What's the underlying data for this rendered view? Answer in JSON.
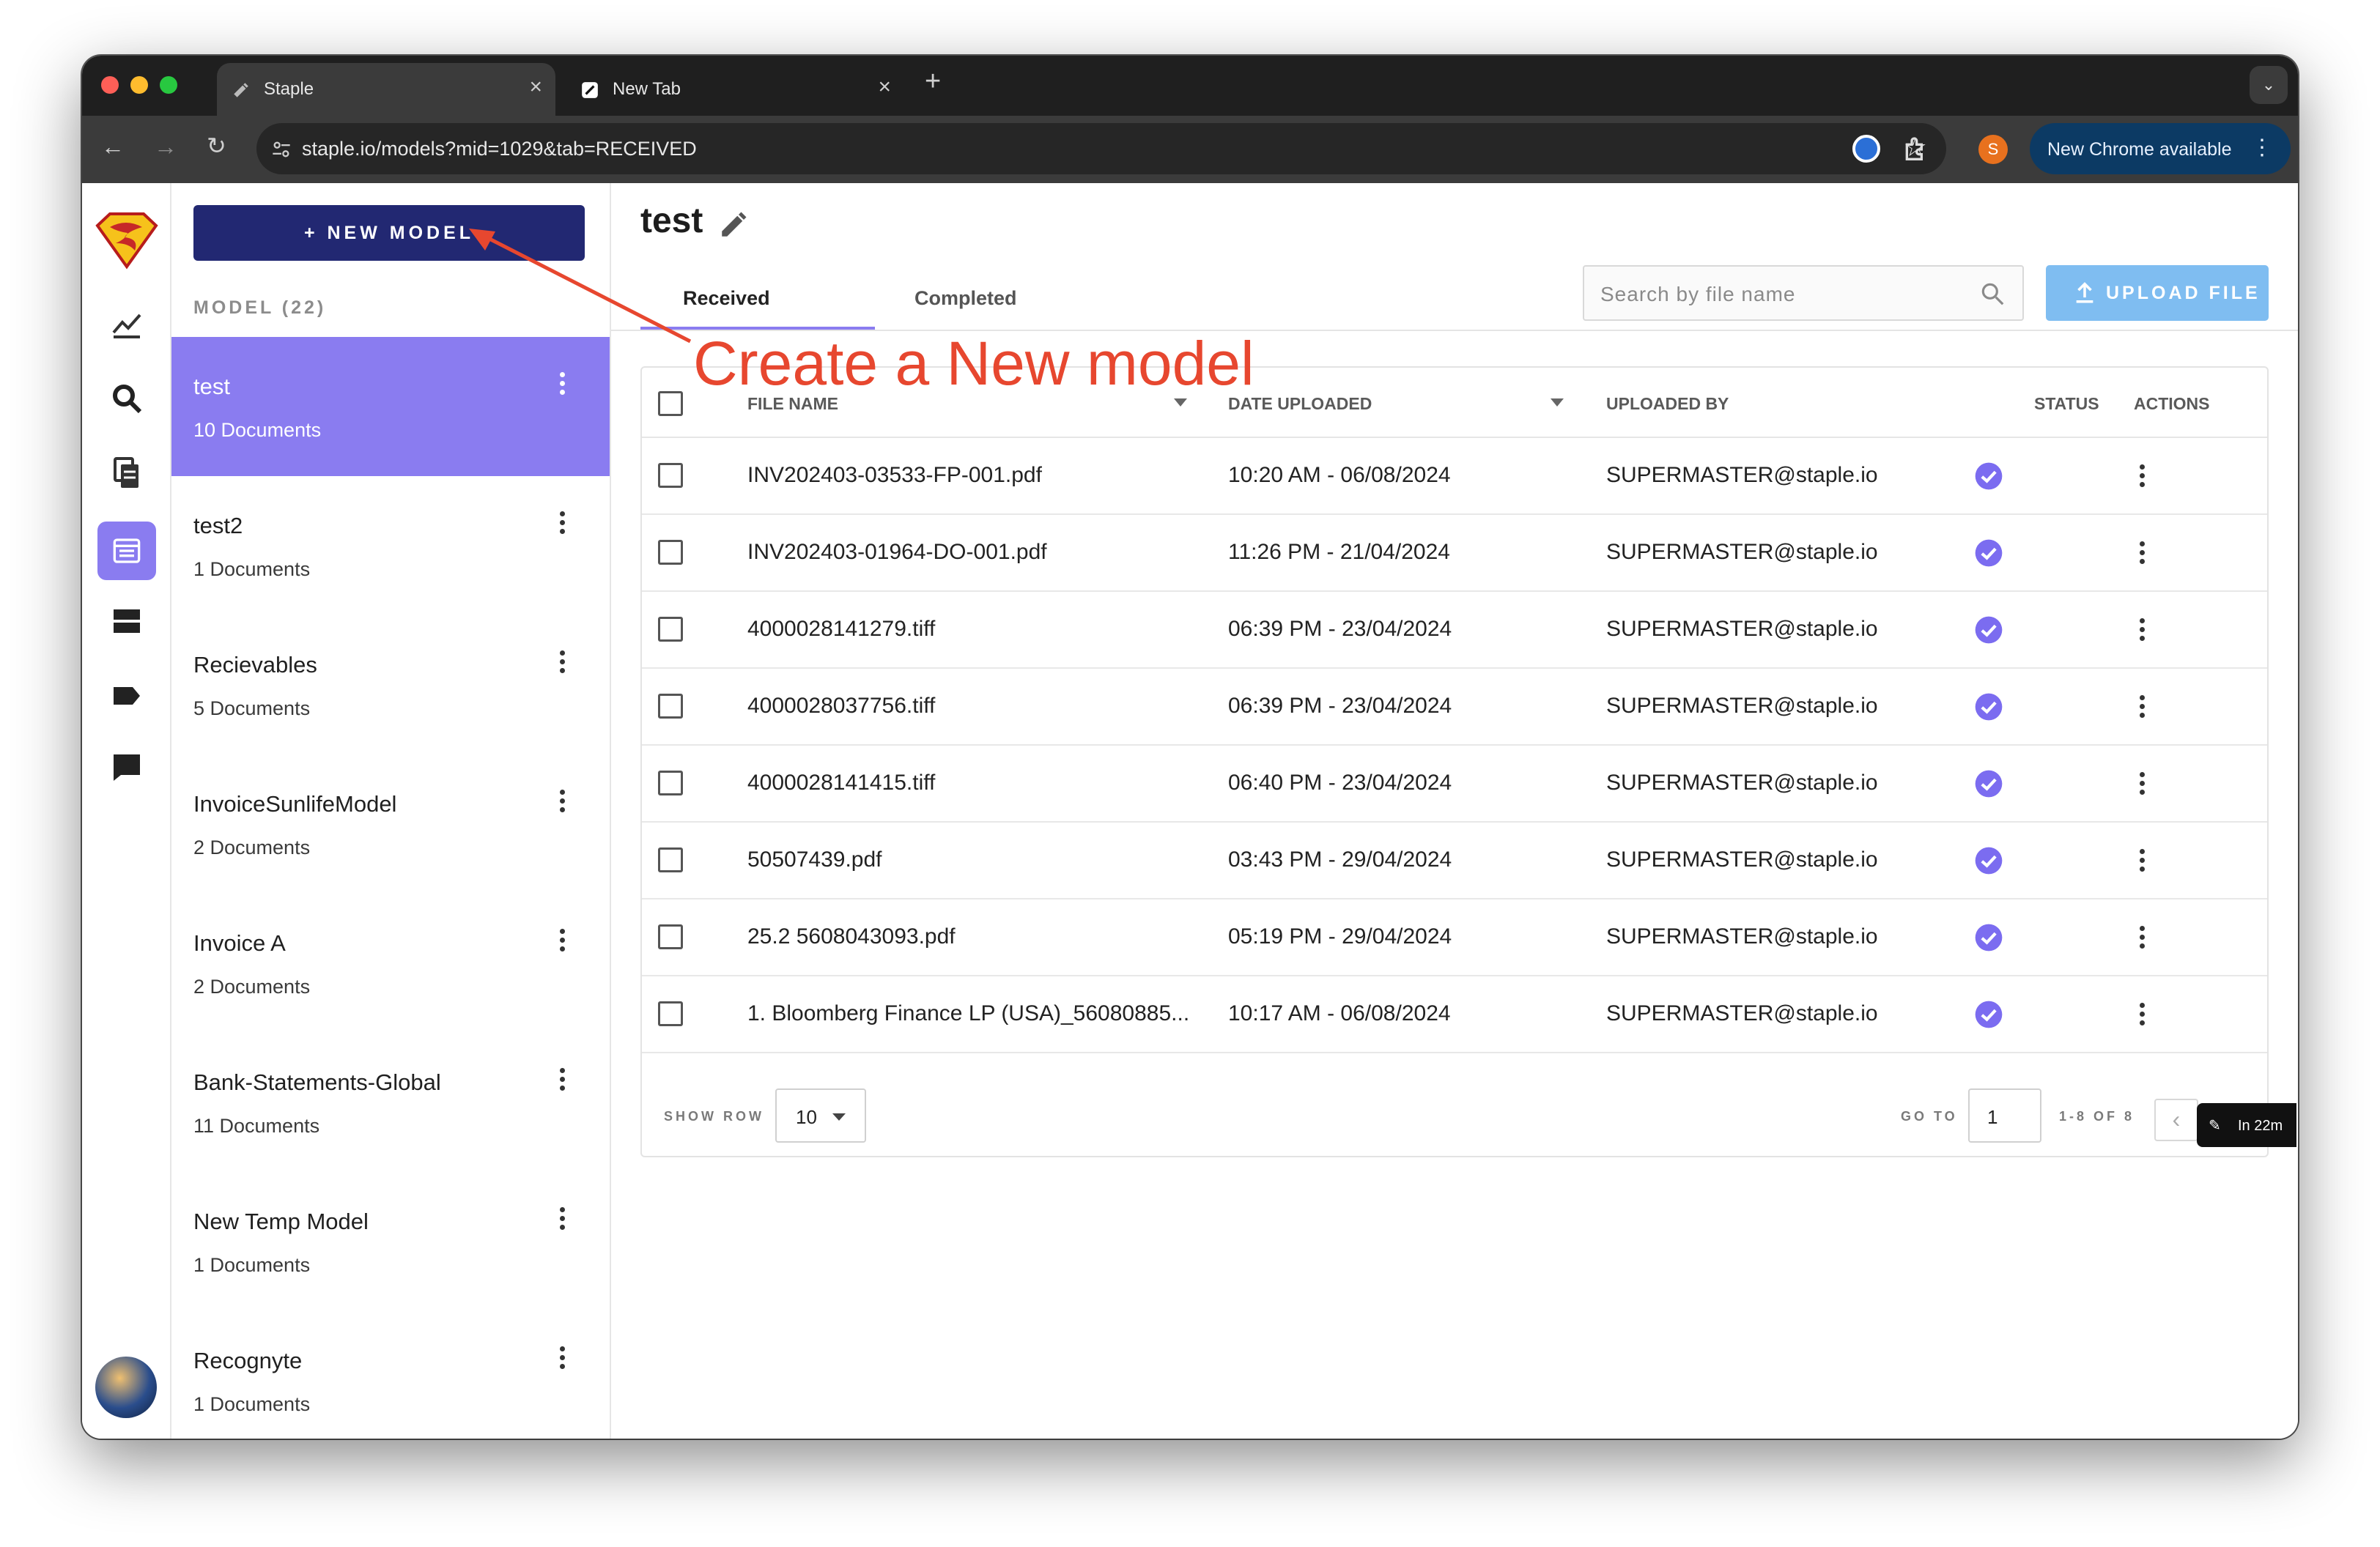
{
  "browser": {
    "tabs": [
      {
        "title": "Staple",
        "active": true
      },
      {
        "title": "New Tab",
        "active": false
      }
    ],
    "url": "staple.io/models?mid=1029&tab=RECEIVED",
    "profile_initial": "S",
    "chrome_update_label": "New Chrome available"
  },
  "sidebar": {
    "new_model_label": "+ NEW MODEL",
    "model_count_label": "MODEL (22)",
    "models": [
      {
        "name": "test",
        "docs": "10 Documents",
        "selected": true
      },
      {
        "name": "test2",
        "docs": "1 Documents"
      },
      {
        "name": "Recievables",
        "docs": "5 Documents"
      },
      {
        "name": "InvoiceSunlifeModel",
        "docs": "2 Documents"
      },
      {
        "name": "Invoice A",
        "docs": "2 Documents"
      },
      {
        "name": "Bank-Statements-Global",
        "docs": "11 Documents"
      },
      {
        "name": "New Temp Model",
        "docs": "1 Documents"
      },
      {
        "name": "Recognyte",
        "docs": "1 Documents"
      }
    ]
  },
  "main": {
    "title": "test",
    "tabs": [
      {
        "label": "Received",
        "active": true
      },
      {
        "label": "Completed",
        "active": false
      }
    ],
    "search_placeholder": "Search by file name",
    "upload_label": "UPLOAD FILE",
    "columns": [
      "FILE NAME",
      "DATE UPLOADED",
      "UPLOADED BY",
      "STATUS",
      "ACTIONS"
    ],
    "rows": [
      {
        "file": "INV202403-03533-FP-001.pdf",
        "date": "10:20 AM - 06/08/2024",
        "by": "SUPERMASTER@staple.io"
      },
      {
        "file": "INV202403-01964-DO-001.pdf",
        "date": "11:26 PM - 21/04/2024",
        "by": "SUPERMASTER@staple.io"
      },
      {
        "file": "4000028141279.tiff",
        "date": "06:39 PM - 23/04/2024",
        "by": "SUPERMASTER@staple.io"
      },
      {
        "file": "4000028037756.tiff",
        "date": "06:39 PM - 23/04/2024",
        "by": "SUPERMASTER@staple.io"
      },
      {
        "file": "4000028141415.tiff",
        "date": "06:40 PM - 23/04/2024",
        "by": "SUPERMASTER@staple.io"
      },
      {
        "file": "50507439.pdf",
        "date": "03:43 PM - 29/04/2024",
        "by": "SUPERMASTER@staple.io"
      },
      {
        "file": "25.2 5608043093.pdf",
        "date": "05:19 PM - 29/04/2024",
        "by": "SUPERMASTER@staple.io"
      },
      {
        "file": "1. Bloomberg Finance LP (USA)_56080885...",
        "date": "10:17 AM - 06/08/2024",
        "by": "SUPERMASTER@staple.io"
      }
    ],
    "footer": {
      "show_row_label": "SHOW ROW",
      "rows_value": "10",
      "goto_label": "GO TO",
      "goto_value": "1",
      "range_label": "1-8 OF 8",
      "toast": "In 22m"
    }
  },
  "annotation": {
    "text": "Create a New model",
    "color": "#e7472f"
  },
  "colors": {
    "accent": "#8a7cf0",
    "primary_button": "#222872",
    "upload_button": "#7fbdf1",
    "status_check": "#7b6cf0"
  }
}
